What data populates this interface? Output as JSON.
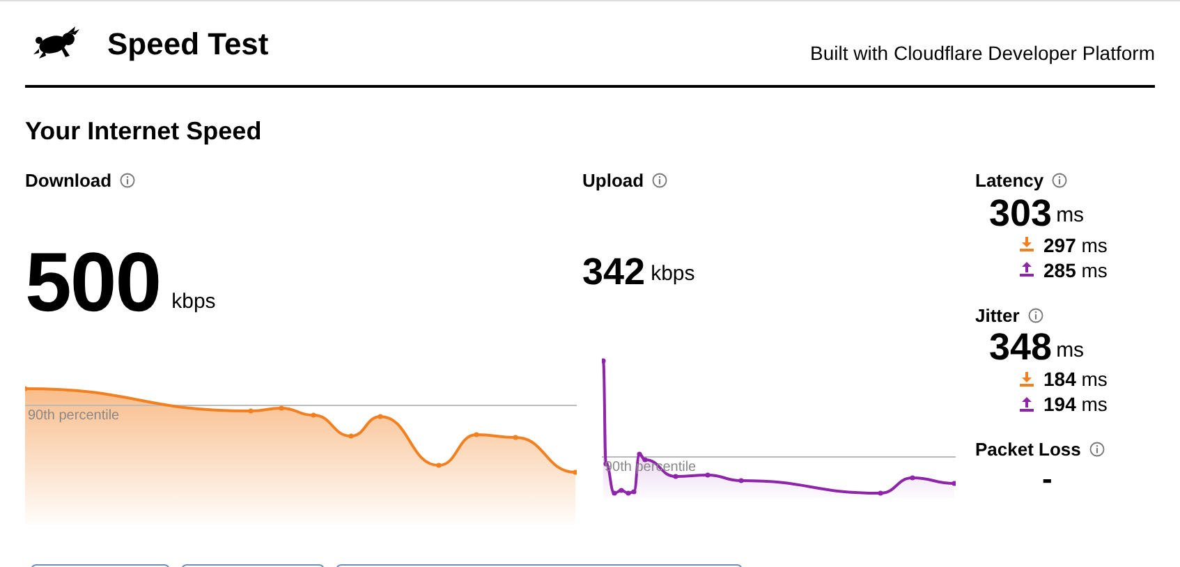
{
  "header": {
    "title": "Speed Test",
    "tagline": "Built with Cloudflare Developer Platform"
  },
  "section_title": "Your Internet Speed",
  "download": {
    "label": "Download",
    "value": "500",
    "unit": "kbps",
    "percentile_label": "90th percentile"
  },
  "upload": {
    "label": "Upload",
    "value": "342",
    "unit": "kbps",
    "percentile_label": "90th percentile"
  },
  "metrics": [
    {
      "label": "Latency",
      "value": "303",
      "unit": "ms",
      "down": {
        "value": "297",
        "unit": "ms"
      },
      "up": {
        "value": "285",
        "unit": "ms"
      }
    },
    {
      "label": "Jitter",
      "value": "348",
      "unit": "ms",
      "down": {
        "value": "184",
        "unit": "ms"
      },
      "up": {
        "value": "194",
        "unit": "ms"
      }
    }
  ],
  "packet_loss": {
    "label": "Packet Loss",
    "value": "-"
  }
}
